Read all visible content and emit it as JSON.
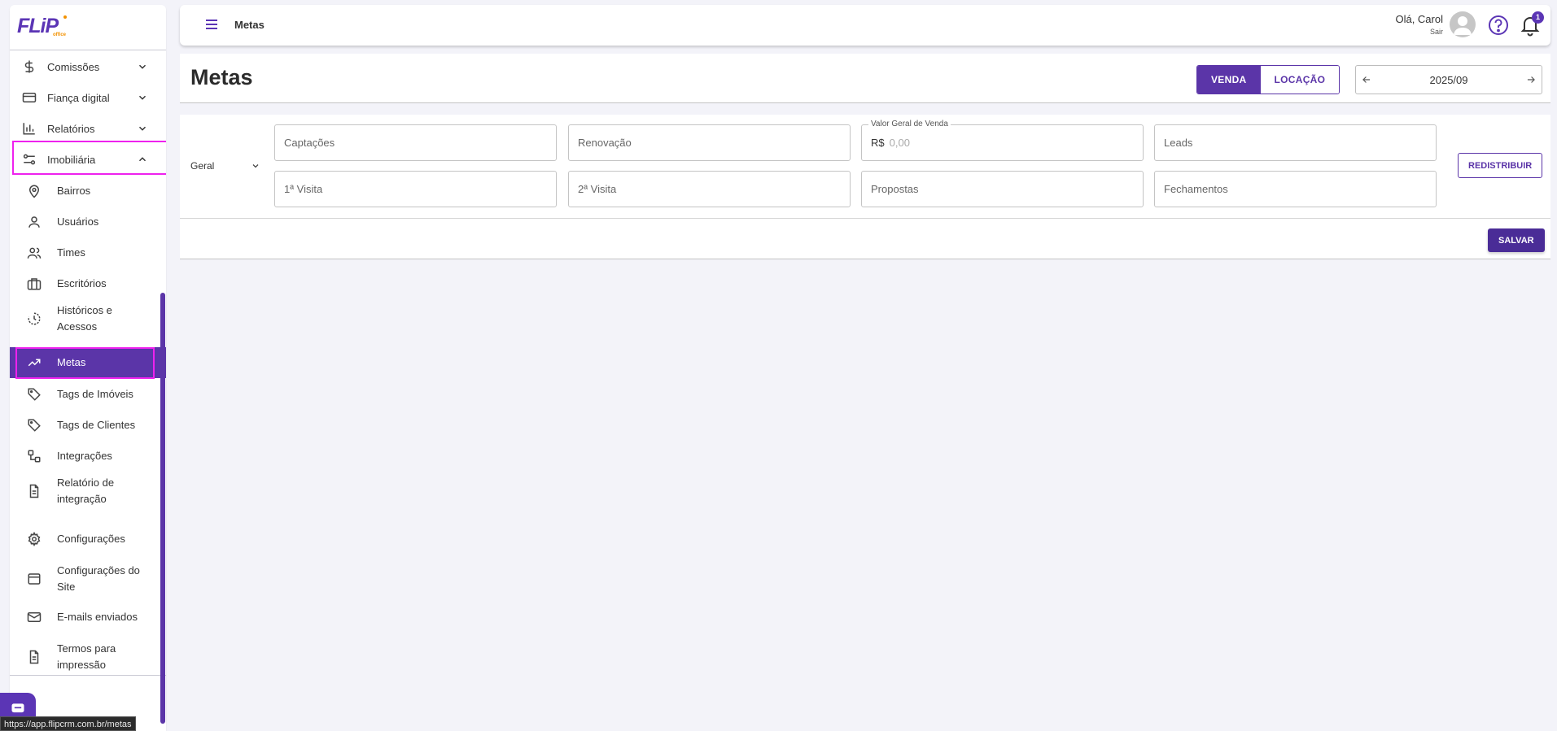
{
  "app": {
    "logo_text": "FLiP",
    "logo_sub": "office",
    "status_url": "https://app.flipcrm.com.br/metas"
  },
  "sidebar": {
    "groups": [
      {
        "label": "Comissões",
        "icon": "dollar-icon"
      },
      {
        "label": "Fiança digital",
        "icon": "credit-card-icon"
      },
      {
        "label": "Relatórios",
        "icon": "bar-chart-icon"
      },
      {
        "label": "Imobiliária",
        "icon": "sliders-icon",
        "expanded": true
      }
    ],
    "items": [
      {
        "label": "Bairros",
        "icon": "map-pin-icon"
      },
      {
        "label": "Usuários",
        "icon": "user-icon"
      },
      {
        "label": "Times",
        "icon": "users-icon"
      },
      {
        "label": "Escritórios",
        "icon": "briefcase-icon"
      },
      {
        "label": "Históricos e Acessos",
        "icon": "history-icon"
      },
      {
        "label": "Metas",
        "icon": "trending-up-icon",
        "active": true
      },
      {
        "label": "Tags de Imóveis",
        "icon": "tag-icon"
      },
      {
        "label": "Tags de Clientes",
        "icon": "tag-icon"
      },
      {
        "label": "Integrações",
        "icon": "integration-icon"
      },
      {
        "label": "Relatório de integração",
        "icon": "file-text-icon"
      },
      {
        "label": "Configurações",
        "icon": "gear-icon"
      },
      {
        "label": "Configurações do Site",
        "icon": "browser-window-icon"
      },
      {
        "label": "E-mails enviados",
        "icon": "mail-icon"
      },
      {
        "label": "Termos para impressão",
        "icon": "file-text-icon"
      }
    ]
  },
  "topbar": {
    "title": "Metas",
    "greeting": "Olá, Carol",
    "logout": "Sair",
    "notification_count": "1"
  },
  "page": {
    "title": "Metas",
    "toggle": {
      "left": "VENDA",
      "right": "LOCAÇÃO",
      "selected": "VENDA"
    },
    "period": "2025/09"
  },
  "goals": {
    "scope": "Geral",
    "fields_row1": [
      {
        "placeholder": "Captações"
      },
      {
        "placeholder": "Renovação"
      },
      {
        "legend": "Valor Geral de Venda",
        "prefix": "R$",
        "placeholder": "0,00"
      },
      {
        "placeholder": "Leads"
      }
    ],
    "fields_row2": [
      {
        "placeholder": "1ª Visita"
      },
      {
        "placeholder": "2ª Visita"
      },
      {
        "placeholder": "Propostas"
      },
      {
        "placeholder": "Fechamentos"
      }
    ],
    "redistribute_label": "REDISTRIBUIR",
    "save_label": "SALVAR"
  },
  "colors": {
    "brand": "#5b35b5",
    "active_bg": "#5b35a8",
    "highlight": "#ee22ee",
    "background": "#f3f3f9"
  }
}
